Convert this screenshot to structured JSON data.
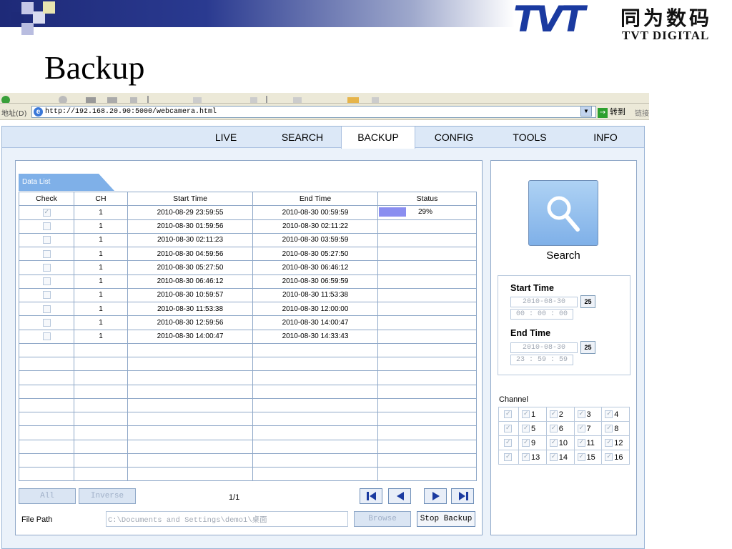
{
  "slide": {
    "title": "Backup",
    "logo": {
      "mark": "TVT",
      "chinese": "同为数码",
      "english": "TVT DIGITAL"
    }
  },
  "browser": {
    "address_label": "地址(D)",
    "url": "http://192.168.20.90:5000/webcamera.html",
    "go_label": "转到",
    "links_label": "链接"
  },
  "nav": {
    "active": "BACKUP",
    "tabs": [
      "LIVE",
      "SEARCH",
      "BACKUP",
      "CONFIG",
      "TOOLS",
      "INFO"
    ]
  },
  "data_list": {
    "tab_label": "Data List",
    "columns": [
      "Check",
      "CH",
      "Start Time",
      "End Time",
      "Status"
    ],
    "rows": [
      {
        "checked": true,
        "ch": "1",
        "start": "2010-08-29 23:59:55",
        "end": "2010-08-30 00:59:59",
        "status": "29%",
        "progress": 0.29
      },
      {
        "checked": false,
        "ch": "1",
        "start": "2010-08-30 01:59:56",
        "end": "2010-08-30 02:11:22",
        "status": ""
      },
      {
        "checked": false,
        "ch": "1",
        "start": "2010-08-30 02:11:23",
        "end": "2010-08-30 03:59:59",
        "status": ""
      },
      {
        "checked": false,
        "ch": "1",
        "start": "2010-08-30 04:59:56",
        "end": "2010-08-30 05:27:50",
        "status": ""
      },
      {
        "checked": false,
        "ch": "1",
        "start": "2010-08-30 05:27:50",
        "end": "2010-08-30 06:46:12",
        "status": ""
      },
      {
        "checked": false,
        "ch": "1",
        "start": "2010-08-30 06:46:12",
        "end": "2010-08-30 06:59:59",
        "status": ""
      },
      {
        "checked": false,
        "ch": "1",
        "start": "2010-08-30 10:59:57",
        "end": "2010-08-30 11:53:38",
        "status": ""
      },
      {
        "checked": false,
        "ch": "1",
        "start": "2010-08-30 11:53:38",
        "end": "2010-08-30 12:00:00",
        "status": ""
      },
      {
        "checked": false,
        "ch": "1",
        "start": "2010-08-30 12:59:56",
        "end": "2010-08-30 14:00:47",
        "status": ""
      },
      {
        "checked": false,
        "ch": "1",
        "start": "2010-08-30 14:00:47",
        "end": "2010-08-30 14:33:43",
        "status": ""
      }
    ],
    "empty_rows": 10,
    "all_label": "All",
    "inverse_label": "Inverse",
    "page": "1/1",
    "file_path_label": "File Path",
    "file_path_value": "C:\\Documents and Settings\\demo1\\桌面",
    "browse_label": "Browse",
    "stop_backup_label": "Stop Backup"
  },
  "side": {
    "search_label": "Search",
    "start_time_label": "Start Time",
    "start_date": "2010-08-30",
    "start_time": "00 : 00 : 00",
    "end_time_label": "End Time",
    "end_date": "2010-08-30",
    "end_time": "23 : 59 : 59",
    "calendar_label": "25",
    "channel_label": "Channel",
    "channels": [
      "1",
      "2",
      "3",
      "4",
      "5",
      "6",
      "7",
      "8",
      "9",
      "10",
      "11",
      "12",
      "13",
      "14",
      "15",
      "16"
    ]
  },
  "colors": {
    "nav_bg": "#dce8f7",
    "panel_border": "#8fa8c8",
    "progress": "#8a8ef0",
    "logo_blue": "#1a3aa0"
  }
}
